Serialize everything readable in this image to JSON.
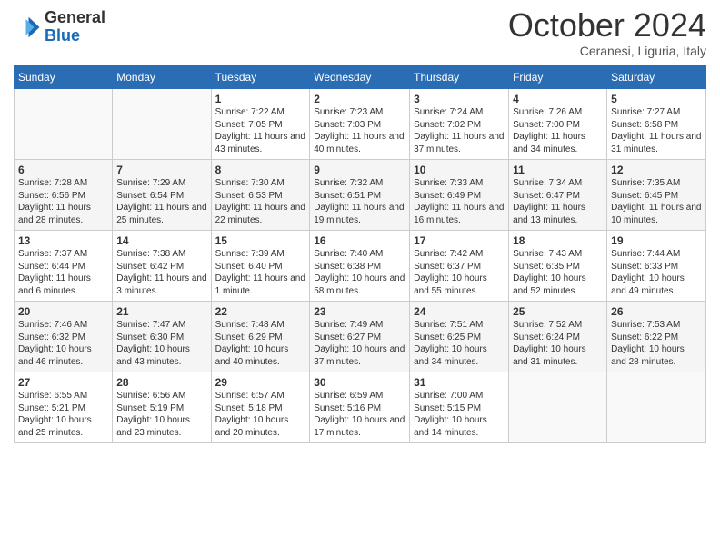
{
  "header": {
    "logo": {
      "general": "General",
      "blue": "Blue"
    },
    "title": "October 2024",
    "location": "Ceranesi, Liguria, Italy"
  },
  "weekdays": [
    "Sunday",
    "Monday",
    "Tuesday",
    "Wednesday",
    "Thursday",
    "Friday",
    "Saturday"
  ],
  "weeks": [
    [
      {
        "day": "",
        "info": ""
      },
      {
        "day": "",
        "info": ""
      },
      {
        "day": "1",
        "info": "Sunrise: 7:22 AM\nSunset: 7:05 PM\nDaylight: 11 hours and 43 minutes."
      },
      {
        "day": "2",
        "info": "Sunrise: 7:23 AM\nSunset: 7:03 PM\nDaylight: 11 hours and 40 minutes."
      },
      {
        "day": "3",
        "info": "Sunrise: 7:24 AM\nSunset: 7:02 PM\nDaylight: 11 hours and 37 minutes."
      },
      {
        "day": "4",
        "info": "Sunrise: 7:26 AM\nSunset: 7:00 PM\nDaylight: 11 hours and 34 minutes."
      },
      {
        "day": "5",
        "info": "Sunrise: 7:27 AM\nSunset: 6:58 PM\nDaylight: 11 hours and 31 minutes."
      }
    ],
    [
      {
        "day": "6",
        "info": "Sunrise: 7:28 AM\nSunset: 6:56 PM\nDaylight: 11 hours and 28 minutes."
      },
      {
        "day": "7",
        "info": "Sunrise: 7:29 AM\nSunset: 6:54 PM\nDaylight: 11 hours and 25 minutes."
      },
      {
        "day": "8",
        "info": "Sunrise: 7:30 AM\nSunset: 6:53 PM\nDaylight: 11 hours and 22 minutes."
      },
      {
        "day": "9",
        "info": "Sunrise: 7:32 AM\nSunset: 6:51 PM\nDaylight: 11 hours and 19 minutes."
      },
      {
        "day": "10",
        "info": "Sunrise: 7:33 AM\nSunset: 6:49 PM\nDaylight: 11 hours and 16 minutes."
      },
      {
        "day": "11",
        "info": "Sunrise: 7:34 AM\nSunset: 6:47 PM\nDaylight: 11 hours and 13 minutes."
      },
      {
        "day": "12",
        "info": "Sunrise: 7:35 AM\nSunset: 6:45 PM\nDaylight: 11 hours and 10 minutes."
      }
    ],
    [
      {
        "day": "13",
        "info": "Sunrise: 7:37 AM\nSunset: 6:44 PM\nDaylight: 11 hours and 6 minutes."
      },
      {
        "day": "14",
        "info": "Sunrise: 7:38 AM\nSunset: 6:42 PM\nDaylight: 11 hours and 3 minutes."
      },
      {
        "day": "15",
        "info": "Sunrise: 7:39 AM\nSunset: 6:40 PM\nDaylight: 11 hours and 1 minute."
      },
      {
        "day": "16",
        "info": "Sunrise: 7:40 AM\nSunset: 6:38 PM\nDaylight: 10 hours and 58 minutes."
      },
      {
        "day": "17",
        "info": "Sunrise: 7:42 AM\nSunset: 6:37 PM\nDaylight: 10 hours and 55 minutes."
      },
      {
        "day": "18",
        "info": "Sunrise: 7:43 AM\nSunset: 6:35 PM\nDaylight: 10 hours and 52 minutes."
      },
      {
        "day": "19",
        "info": "Sunrise: 7:44 AM\nSunset: 6:33 PM\nDaylight: 10 hours and 49 minutes."
      }
    ],
    [
      {
        "day": "20",
        "info": "Sunrise: 7:46 AM\nSunset: 6:32 PM\nDaylight: 10 hours and 46 minutes."
      },
      {
        "day": "21",
        "info": "Sunrise: 7:47 AM\nSunset: 6:30 PM\nDaylight: 10 hours and 43 minutes."
      },
      {
        "day": "22",
        "info": "Sunrise: 7:48 AM\nSunset: 6:29 PM\nDaylight: 10 hours and 40 minutes."
      },
      {
        "day": "23",
        "info": "Sunrise: 7:49 AM\nSunset: 6:27 PM\nDaylight: 10 hours and 37 minutes."
      },
      {
        "day": "24",
        "info": "Sunrise: 7:51 AM\nSunset: 6:25 PM\nDaylight: 10 hours and 34 minutes."
      },
      {
        "day": "25",
        "info": "Sunrise: 7:52 AM\nSunset: 6:24 PM\nDaylight: 10 hours and 31 minutes."
      },
      {
        "day": "26",
        "info": "Sunrise: 7:53 AM\nSunset: 6:22 PM\nDaylight: 10 hours and 28 minutes."
      }
    ],
    [
      {
        "day": "27",
        "info": "Sunrise: 6:55 AM\nSunset: 5:21 PM\nDaylight: 10 hours and 25 minutes."
      },
      {
        "day": "28",
        "info": "Sunrise: 6:56 AM\nSunset: 5:19 PM\nDaylight: 10 hours and 23 minutes."
      },
      {
        "day": "29",
        "info": "Sunrise: 6:57 AM\nSunset: 5:18 PM\nDaylight: 10 hours and 20 minutes."
      },
      {
        "day": "30",
        "info": "Sunrise: 6:59 AM\nSunset: 5:16 PM\nDaylight: 10 hours and 17 minutes."
      },
      {
        "day": "31",
        "info": "Sunrise: 7:00 AM\nSunset: 5:15 PM\nDaylight: 10 hours and 14 minutes."
      },
      {
        "day": "",
        "info": ""
      },
      {
        "day": "",
        "info": ""
      }
    ]
  ]
}
